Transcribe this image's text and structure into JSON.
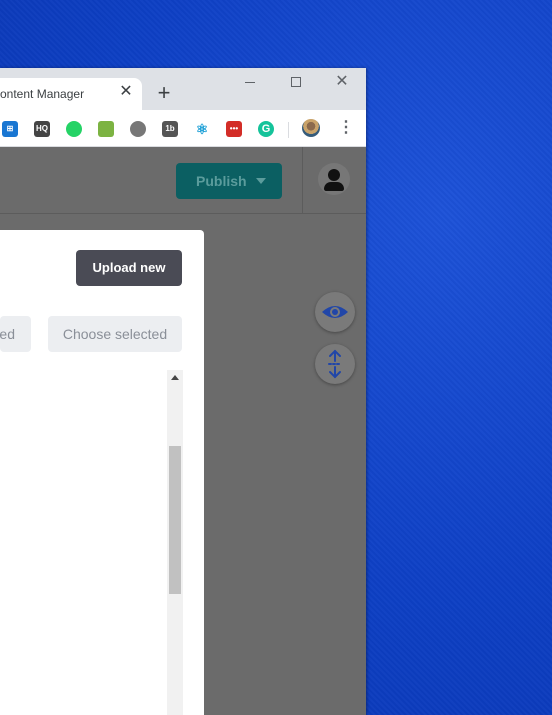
{
  "browser": {
    "tab_title": "ontent Manager",
    "tab_close": "✕",
    "new_tab": "+",
    "window_close": "✕",
    "menu": "⋮",
    "extensions": [
      {
        "name": "extension-1-icon",
        "text": "⊞",
        "color": "#1976d2"
      },
      {
        "name": "cloudhq-icon",
        "text": "HQ",
        "color": "#444444"
      },
      {
        "name": "whatsapp-icon",
        "text": "",
        "color": "#25d366"
      },
      {
        "name": "checkmail-icon",
        "text": "",
        "color": "#7cb342"
      },
      {
        "name": "link-icon",
        "text": "",
        "color": "#777777"
      },
      {
        "name": "1b-icon",
        "text": "1b",
        "color": "#555555"
      },
      {
        "name": "react-icon",
        "text": "⚛",
        "color": "#1b9fd6"
      },
      {
        "name": "lastpass-icon",
        "text": "•••",
        "color": "#d32d27"
      },
      {
        "name": "grammarly-icon",
        "text": "G",
        "color": "#15c39a"
      }
    ]
  },
  "appbar": {
    "publish_label": "Publish",
    "publish_color": "#0b5f62"
  },
  "modal": {
    "upload_label": "Upload new",
    "selected_partial_label": "ed",
    "choose_selected_label": "Choose selected"
  },
  "fabs": {
    "eye_color": "#2146a8",
    "move_color": "#2146a8"
  }
}
